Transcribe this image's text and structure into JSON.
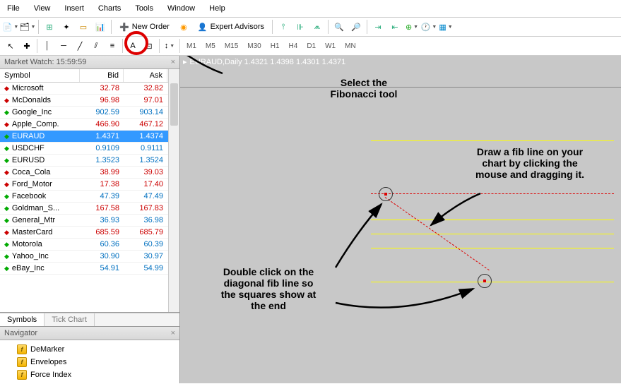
{
  "menu": [
    "File",
    "View",
    "Insert",
    "Charts",
    "Tools",
    "Window",
    "Help"
  ],
  "toolbar1": {
    "new_order": "New Order",
    "expert_advisors": "Expert Advisors"
  },
  "timeframes": [
    "M1",
    "M5",
    "M15",
    "M30",
    "H1",
    "H4",
    "D1",
    "W1",
    "MN"
  ],
  "marketWatch": {
    "title": "Market Watch: 15:59:59",
    "cols": {
      "symbol": "Symbol",
      "bid": "Bid",
      "ask": "Ask"
    },
    "rows": [
      {
        "sym": "Microsoft",
        "bid": "32.78",
        "ask": "32.82",
        "dir": "dn",
        "cls": "price-dn"
      },
      {
        "sym": "McDonalds",
        "bid": "96.98",
        "ask": "97.01",
        "dir": "dn",
        "cls": "price-dn"
      },
      {
        "sym": "Google_Inc",
        "bid": "902.59",
        "ask": "903.14",
        "dir": "up",
        "cls": "price-up"
      },
      {
        "sym": "Apple_Comp.",
        "bid": "466.90",
        "ask": "467.12",
        "dir": "dn",
        "cls": "price-dn"
      },
      {
        "sym": "EURAUD",
        "bid": "1.4371",
        "ask": "1.4374",
        "dir": "up",
        "cls": "",
        "sel": true
      },
      {
        "sym": "USDCHF",
        "bid": "0.9109",
        "ask": "0.9111",
        "dir": "up",
        "cls": "price-up"
      },
      {
        "sym": "EURUSD",
        "bid": "1.3523",
        "ask": "1.3524",
        "dir": "up",
        "cls": "price-up"
      },
      {
        "sym": "Coca_Cola",
        "bid": "38.99",
        "ask": "39.03",
        "dir": "dn",
        "cls": "price-dn"
      },
      {
        "sym": "Ford_Motor",
        "bid": "17.38",
        "ask": "17.40",
        "dir": "dn",
        "cls": "price-dn"
      },
      {
        "sym": "Facebook",
        "bid": "47.39",
        "ask": "47.49",
        "dir": "up",
        "cls": "price-up"
      },
      {
        "sym": "Goldman_S...",
        "bid": "167.58",
        "ask": "167.83",
        "dir": "up",
        "cls": "price-dn"
      },
      {
        "sym": "General_Mtr",
        "bid": "36.93",
        "ask": "36.98",
        "dir": "up",
        "cls": "price-up"
      },
      {
        "sym": "MasterCard",
        "bid": "685.59",
        "ask": "685.79",
        "dir": "dn",
        "cls": "price-dn"
      },
      {
        "sym": "Motorola",
        "bid": "60.36",
        "ask": "60.39",
        "dir": "up",
        "cls": "price-up"
      },
      {
        "sym": "Yahoo_Inc",
        "bid": "30.90",
        "ask": "30.97",
        "dir": "up",
        "cls": "price-up"
      },
      {
        "sym": "eBay_Inc",
        "bid": "54.91",
        "ask": "54.99",
        "dir": "up",
        "cls": "price-up"
      }
    ],
    "tabs": {
      "symbols": "Symbols",
      "tick": "Tick Chart"
    }
  },
  "navigator": {
    "title": "Navigator",
    "items": [
      "DeMarker",
      "Envelopes",
      "Force Index"
    ]
  },
  "chart": {
    "title": "EURAUD,Daily  1.4321 1.4398 1.4301 1.4371"
  },
  "annotations": {
    "a1": "Select the\nFibonacci tool",
    "a2": "Draw a fib line on your\nchart by clicking the\nmouse and dragging it.",
    "a3": "Double click on the\ndiagonal fib line so\nthe squares show at\nthe end"
  }
}
